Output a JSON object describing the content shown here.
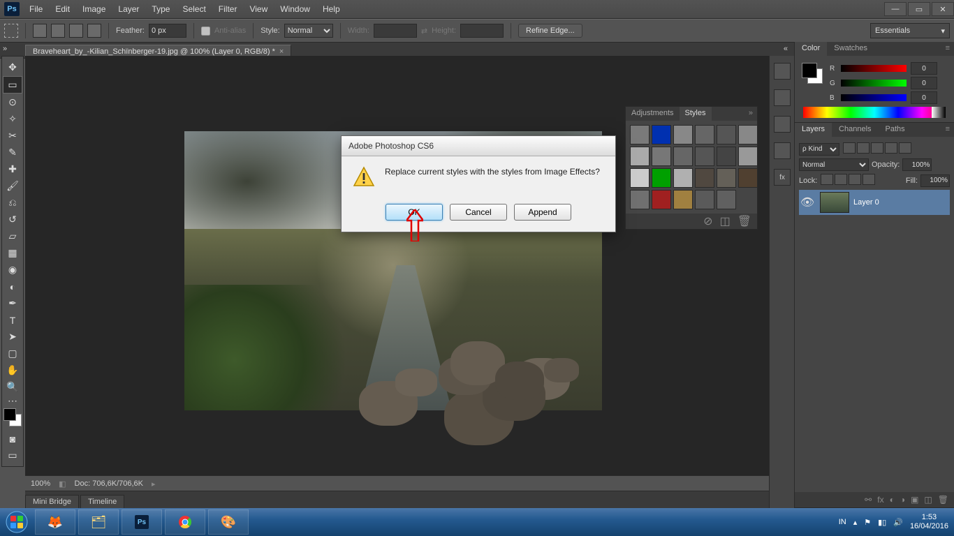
{
  "titlebar": {},
  "menu": {
    "items": [
      "File",
      "Edit",
      "Image",
      "Layer",
      "Type",
      "Select",
      "Filter",
      "View",
      "Window",
      "Help"
    ]
  },
  "options": {
    "feather_label": "Feather:",
    "feather_value": "0 px",
    "antialias": "Anti-alias",
    "style_label": "Style:",
    "style_value": "Normal",
    "width_label": "Width:",
    "height_label": "Height:",
    "refine": "Refine Edge...",
    "workspace": "Essentials"
  },
  "tab": {
    "title": "Braveheart_by_-Kilian_Schïnberger-19.jpg @ 100% (Layer 0, RGB/8) *"
  },
  "status": {
    "zoom": "100%",
    "doc": "Doc: 706,6K/706,6K"
  },
  "bottom_tabs": [
    "Mini Bridge",
    "Timeline"
  ],
  "float_panel": {
    "tabs": [
      "Adjustments",
      "Styles"
    ],
    "colors": [
      "#7a7a7a",
      "#0030b0",
      "#888",
      "#666",
      "#555",
      "#888",
      "#aaa",
      "#777",
      "#666",
      "#555",
      "#444",
      "#999",
      "#ccc",
      "#00a000",
      "#b0b0b0",
      "#504840",
      "#646058",
      "#504030",
      "#707070",
      "#a02020",
      "#a08040",
      "#5a5a5a",
      "#606060"
    ]
  },
  "color_panel": {
    "tabs": [
      "Color",
      "Swatches"
    ],
    "r": "0",
    "g": "0",
    "b": "0"
  },
  "layers_panel": {
    "tabs": [
      "Layers",
      "Channels",
      "Paths"
    ],
    "kind": "Kind",
    "blend": "Normal",
    "opacity_label": "Opacity:",
    "opacity": "100%",
    "lock_label": "Lock:",
    "fill_label": "Fill:",
    "fill": "100%",
    "layer_name": "Layer 0"
  },
  "dialog": {
    "title": "Adobe Photoshop CS6",
    "message": "Replace current styles with the styles from Image Effects?",
    "ok": "OK",
    "cancel": "Cancel",
    "append": "Append"
  },
  "taskbar": {
    "lang": "IN",
    "time": "1:53",
    "date": "16/04/2016"
  }
}
